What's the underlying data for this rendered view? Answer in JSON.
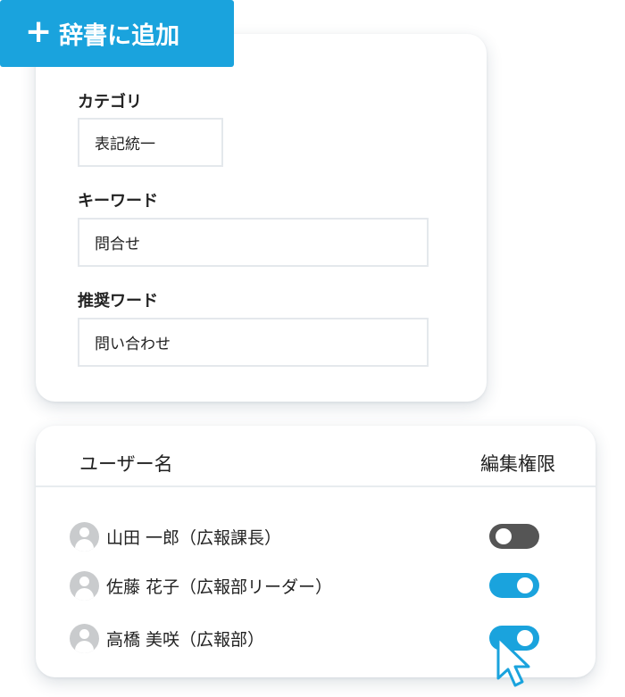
{
  "banner": {
    "plus_icon": "plus-icon",
    "label": "辞書に追加"
  },
  "dictionary_form": {
    "category": {
      "label": "カテゴリ",
      "value": "表記統一"
    },
    "keyword": {
      "label": "キーワード",
      "value": "問合せ"
    },
    "recommended": {
      "label": "推奨ワード",
      "value": "問い合わせ"
    }
  },
  "permissions": {
    "header_user": "ユーザー名",
    "header_permission": "編集権限",
    "users": [
      {
        "name": "山田 一郎（広報課長）",
        "avatar_icon": "user-avatar-icon",
        "edit_permission": false
      },
      {
        "name": "佐藤 花子（広報部リーダー）",
        "avatar_icon": "user-avatar-icon",
        "edit_permission": true
      },
      {
        "name": "高橋 美咲（広報部）",
        "avatar_icon": "user-avatar-icon",
        "edit_permission": true
      }
    ]
  },
  "colors": {
    "accent": "#1aa3dd",
    "toggle_off": "#555555",
    "avatar": "#c9cbcd"
  },
  "cursor_icon": "mouse-pointer-icon"
}
